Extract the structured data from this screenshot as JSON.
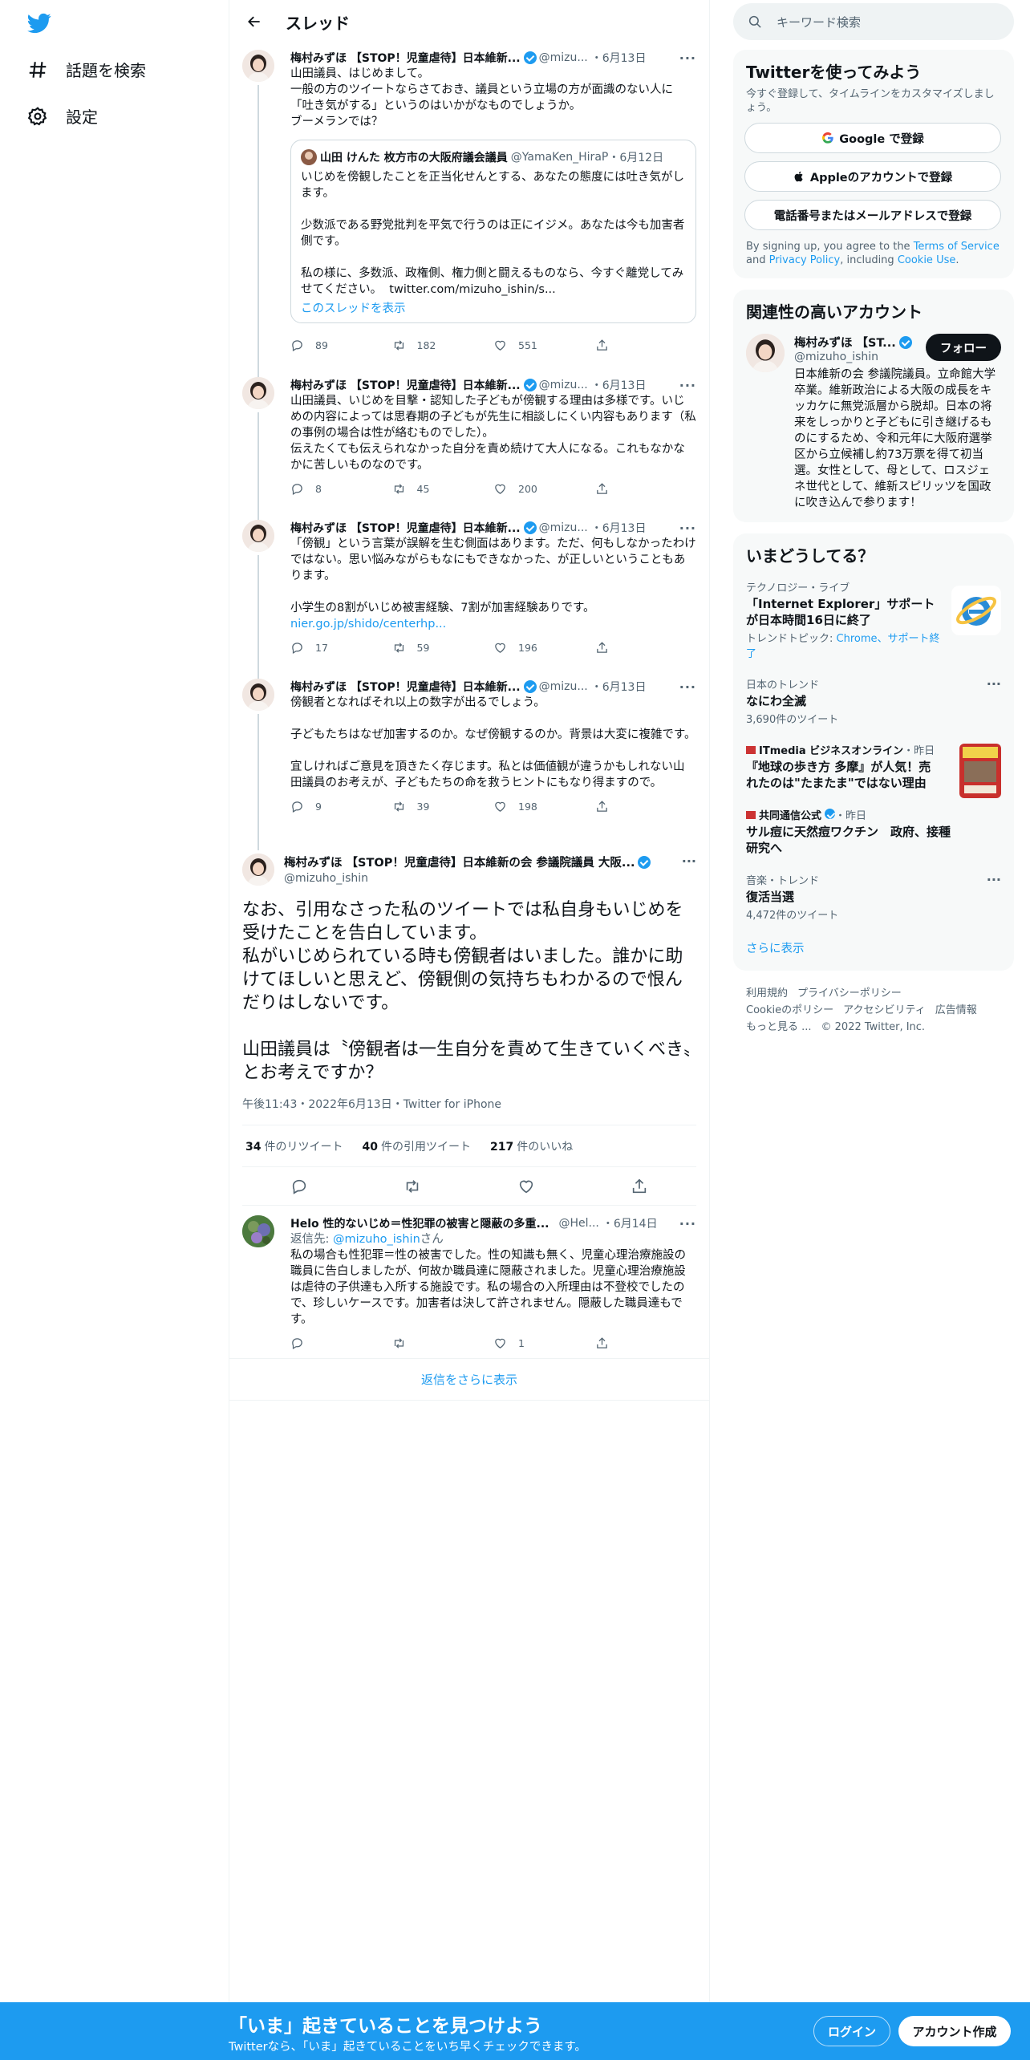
{
  "nav": {
    "explore_label": "話題を検索",
    "settings_label": "設定"
  },
  "header": {
    "title": "スレッド"
  },
  "thread": [
    {
      "name": "梅村みずほ 【STOP！児童虐待】日本維新...",
      "handle": "@mizu...",
      "date": "6月13日",
      "text": "山田議員、はじめまして。\n一般の方のツイートならさておき、議員という立場の方が面識のない人に「吐き気がする」というのはいかがなものでしょうか。\nブーメランでは？",
      "quote": {
        "name": "山田 けんた 枚方市の大阪府議会議員",
        "handle": "@YamaKen_HiraP",
        "date": "6月12日",
        "text": "いじめを傍観したことを正当化せんとする、あなたの態度には吐き気がします。\n\n少数派である野党批判を平気で行うのは正にイジメ。あなたは今も加害者側です。\n\n私の様に、多数派、政権側、権力側と闘えるものなら、今すぐ離党してみせてください。",
        "link": "twitter.com/mizuho_ishin/s...",
        "show_thread": "このスレッドを表示"
      },
      "replies": "89",
      "retweets": "182",
      "likes": "551"
    },
    {
      "name": "梅村みずほ 【STOP！児童虐待】日本維新...",
      "handle": "@mizu...",
      "date": "6月13日",
      "text": "山田議員、いじめを目撃・認知した子どもが傍観する理由は多様です。いじめの内容によっては思春期の子どもが先生に相談しにくい内容もあります（私の事例の場合は性が絡むものでした）。\n伝えたくても伝えられなかった自分を責め続けて大人になる。これもなかなかに苦しいものなのです。",
      "replies": "8",
      "retweets": "45",
      "likes": "200"
    },
    {
      "name": "梅村みずほ 【STOP！児童虐待】日本維新...",
      "handle": "@mizu...",
      "date": "6月13日",
      "text": "「傍観」という言葉が誤解を生む側面はあります。ただ、何もしなかったわけではない。思い悩みながらもなにもできなかった、が正しいということもあります。\n\n小学生の8割がいじめ被害経験、7割が加害経験ありです。",
      "link": "nier.go.jp/shido/centerhp...",
      "replies": "17",
      "retweets": "59",
      "likes": "196"
    },
    {
      "name": "梅村みずほ 【STOP！児童虐待】日本維新...",
      "handle": "@mizu...",
      "date": "6月13日",
      "text": "傍観者となればそれ以上の数字が出るでしょう。\n\n子どもたちはなぜ加害するのか。なぜ傍観するのか。背景は大変に複雑です。\n\n宜しければご意見を頂きたく存じます。私とは価値観が違うかもしれない山田議員のお考えが、子どもたちの命を救うヒントにもなり得ますので。",
      "replies": "9",
      "retweets": "39",
      "likes": "198"
    }
  ],
  "focus": {
    "name": "梅村みずほ 【STOP！児童虐待】日本維新の会 参議院議員 大阪...",
    "handle": "@mizuho_ishin",
    "text": "なお、引用なさった私のツイートでは私自身もいじめを受けたことを告白しています。\n私がいじめられている時も傍観者はいました。誰かに助けてほしいと思えど、傍観側の気持ちもわかるので恨んだりはしないです。\n\n山田議員は〝傍観者は一生自分を責めて生きていくべき〟とお考えですか？",
    "meta": "午後11:43・2022年6月13日・Twitter for iPhone",
    "retweets_count": "34",
    "retweets_label": "件のリツイート",
    "quotes_count": "40",
    "quotes_label": "件の引用ツイート",
    "likes_count": "217",
    "likes_label": "件のいいね"
  },
  "reply": {
    "name": "Helo 性的ないじめ＝性犯罪の被害と隠蔽の多重...",
    "handle": "@Hel...",
    "date": "6月14日",
    "reply_to_prefix": "返信先: ",
    "reply_to": "@mizuho_ishin",
    "reply_to_suffix": "さん",
    "text": "私の場合も性犯罪＝性の被害でした。性の知識も無く、児童心理治療施設の職員に告白しましたが、何故か職員達に隠蔽されました。児童心理治療施設は虐待の子供達も入所する施設です。私の場合の入所理由は不登校でしたので、珍しいケースです。加害者は決して許されません。隠蔽した職員達もです。",
    "likes": "1"
  },
  "show_more_replies": "返信をさらに表示",
  "search": {
    "placeholder": "キーワード検索"
  },
  "signup": {
    "title": "Twitterを使ってみよう",
    "subtitle": "今すぐ登録して、タイムラインをカスタマイズしましょう。",
    "google": "Google で登録",
    "apple": "Appleのアカウントで登録",
    "phone": "電話番号またはメールアドレスで登録",
    "terms_prefix": "By signing up, you agree to the ",
    "terms_link": "Terms of Service",
    "terms_and": " and ",
    "privacy_link": "Privacy Policy",
    "terms_including": ", including ",
    "cookie_link": "Cookie Use",
    "terms_end": "."
  },
  "relevant": {
    "title": "関連性の高いアカウント",
    "name": "梅村みずほ 【ST...",
    "handle": "@mizuho_ishin",
    "follow": "フォロー",
    "bio": "日本維新の会 参議院議員。立命館大学卒業。維新政治による大阪の成長をキッカケに無党派層から脱却。日本の将来をしっかりと子どもに引き継げるものにするため、令和元年に大阪府選挙区から立候補し約73万票を得て初当選。女性として、母として、ロスジェネ世代として、維新スピリッツを国政に吹き込んで参ります！"
  },
  "trends": {
    "title": "いまどうしてる？",
    "items": [
      {
        "category": "テクノロジー・ライブ",
        "title": "「Internet Explorer」サポートが日本時間16日に終了",
        "topic_prefix": "トレンドトピック: ",
        "topic": "Chrome、サポート終了"
      },
      {
        "category": "日本のトレンド",
        "title": "なにわ全滅",
        "count": "3,690件のツイート"
      },
      {
        "category": "ITmedia ビジネスオンライン",
        "category_suffix": "・昨日",
        "title": "『地球の歩き方 多摩』が人気！売れたのは\"たまたま\"ではない理由"
      },
      {
        "category": "共同通信公式",
        "category_suffix": "・昨日",
        "title": "サル痘に天然痘ワクチン　政府、接種研究へ"
      },
      {
        "category": "音楽・トレンド",
        "title": "復活当選",
        "count": "4,472件のツイート"
      }
    ],
    "show_more": "さらに表示"
  },
  "footer": {
    "links": [
      "利用規約",
      "プライバシーポリシー",
      "Cookieのポリシー",
      "アクセシビリティ",
      "広告情報",
      "もっと見る ..."
    ],
    "copyright": "© 2022 Twitter, Inc."
  },
  "bottom": {
    "title": "「いま」起きていることを見つけよう",
    "subtitle": "Twitterなら、「いま」起きていることをいち早くチェックできます。",
    "login": "ログイン",
    "signup": "アカウント作成"
  },
  "colors": {
    "accent": "#1d9bf0",
    "text": "#0f1419",
    "secondary": "#536471"
  }
}
